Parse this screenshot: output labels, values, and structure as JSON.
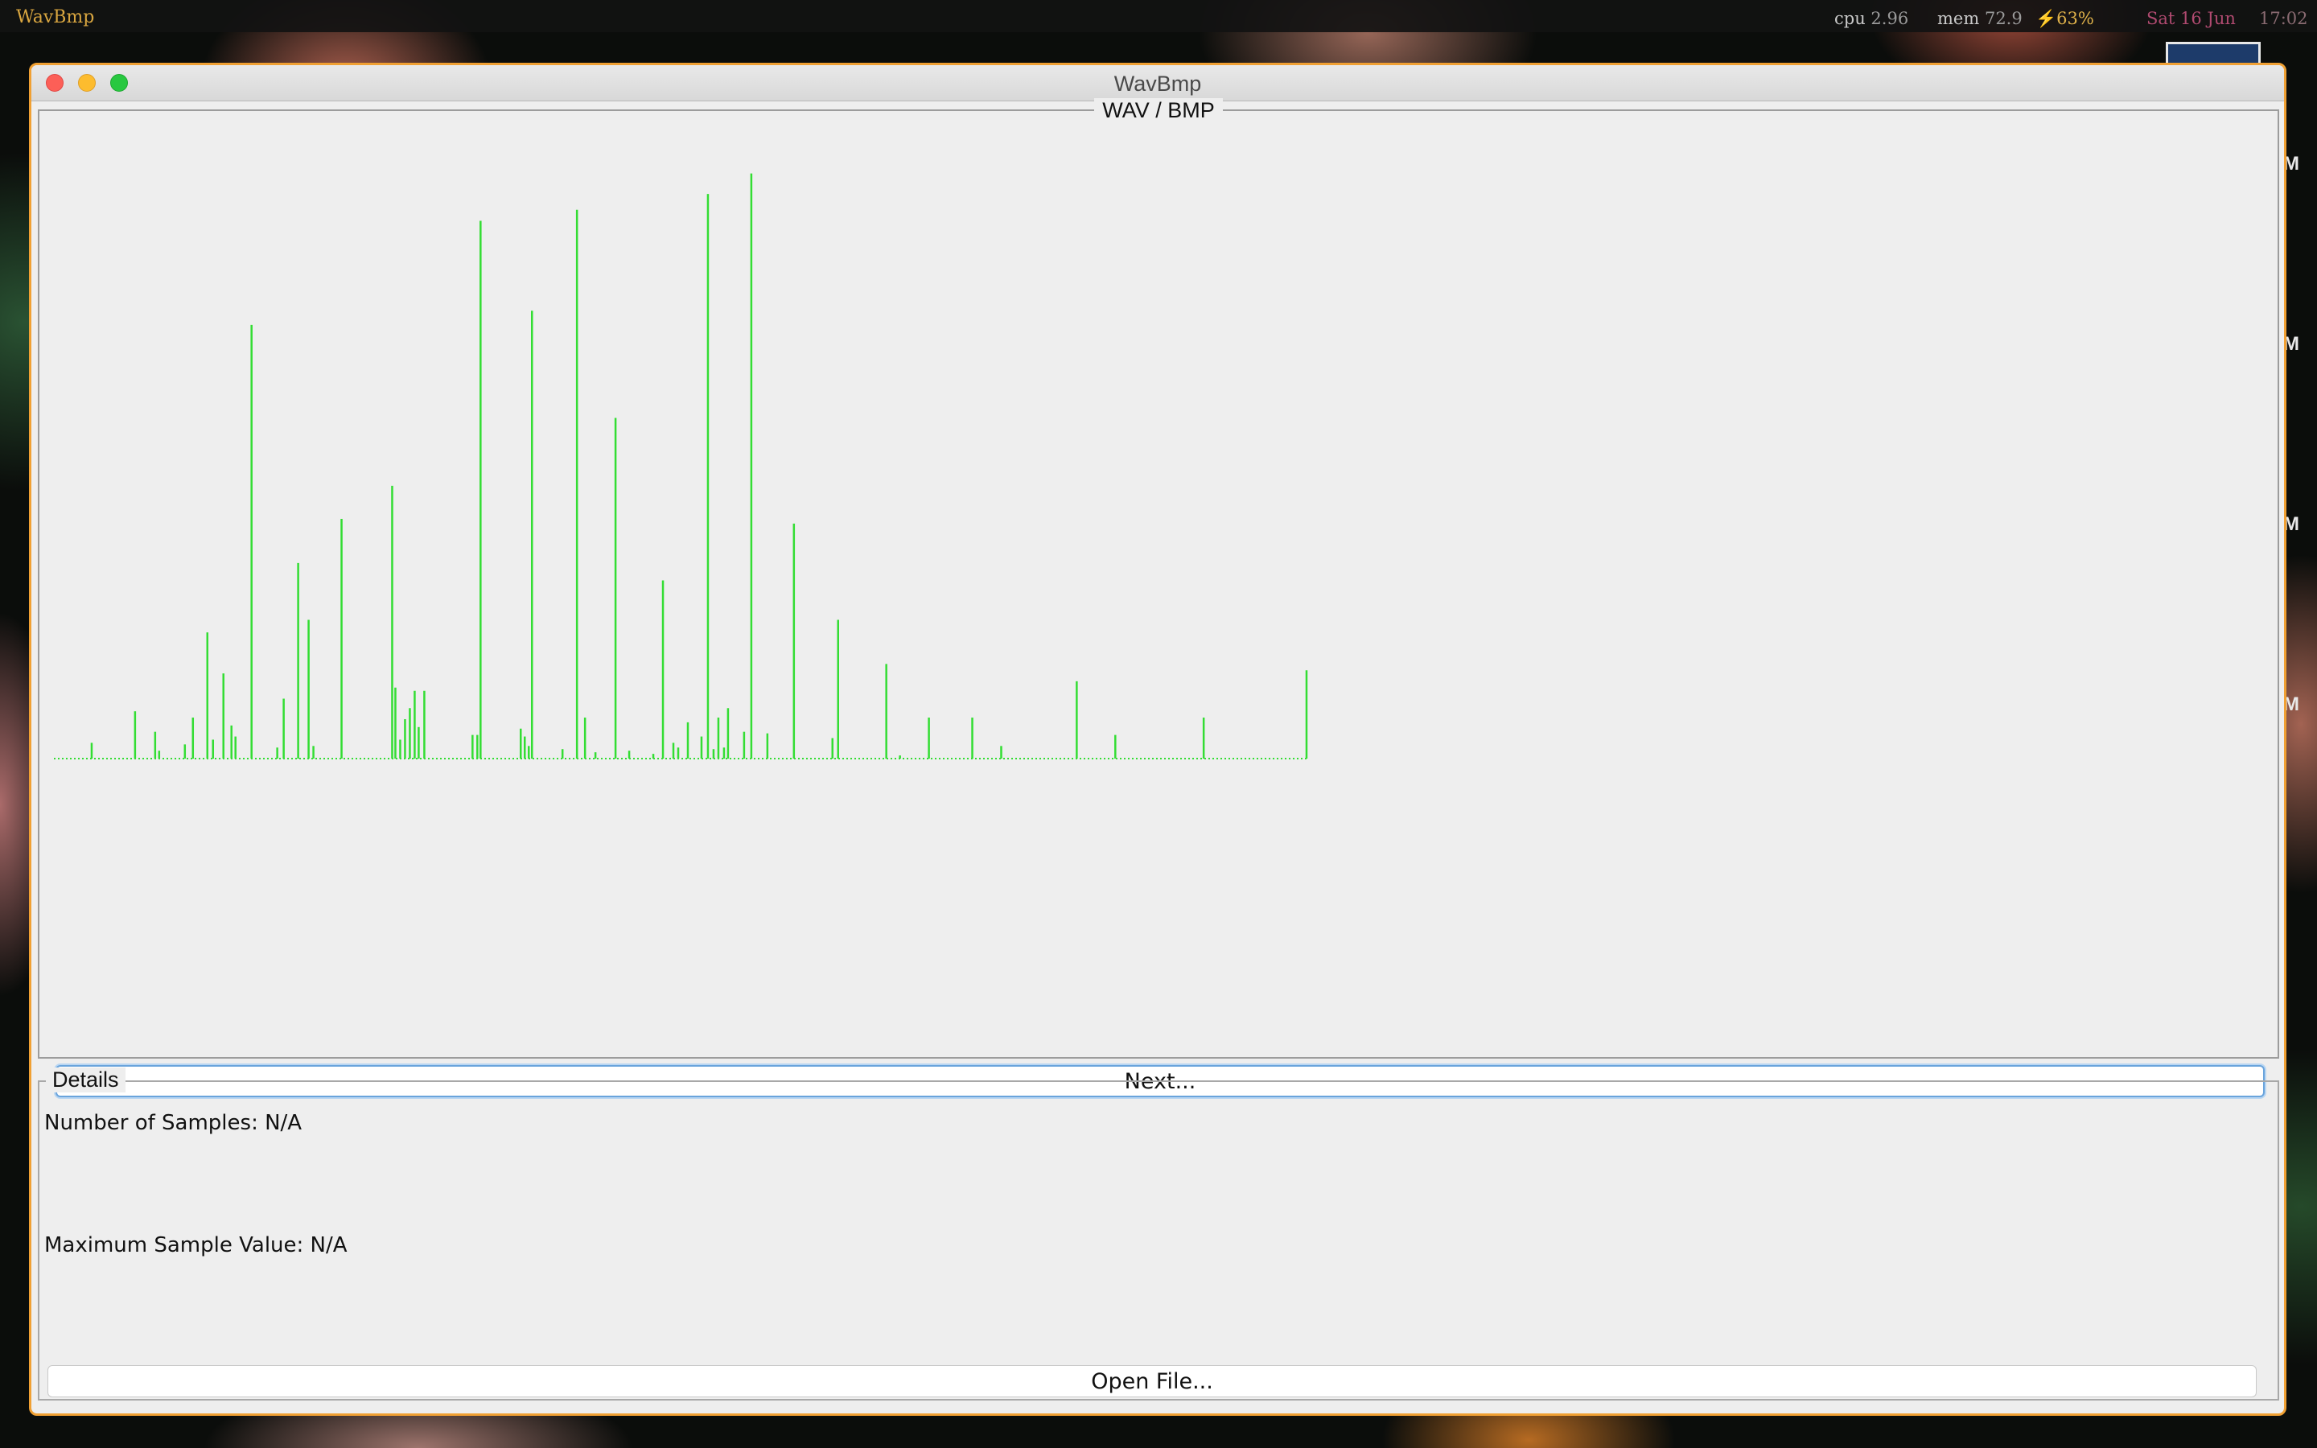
{
  "menubar": {
    "app_name": "WavBmp",
    "cpu_label": "cpu",
    "cpu_value": "2.96",
    "mem_label": "mem",
    "mem_value": "72.9",
    "battery": "⚡63%",
    "date": "Sat 16 Jun",
    "time": "17:02"
  },
  "desktop": {
    "side_labels": [
      "M",
      "M",
      "M",
      "M"
    ]
  },
  "window": {
    "title": "WavBmp",
    "chart_panel_title": "WAV / BMP",
    "next_button_label": "Next...",
    "details_title": "Details",
    "samples_label": "Number of Samples: N/A",
    "max_value_label": "Maximum Sample Value: N/A",
    "open_button_label": "Open File..."
  },
  "colors": {
    "waveform": "#33dd33",
    "window_border": "#f0a033",
    "focus_ring": "#6aa4dc"
  },
  "chart_data": {
    "type": "bar",
    "values": [
      0,
      0,
      0,
      0,
      0,
      0,
      0,
      0,
      1,
      0,
      0,
      0,
      0,
      0,
      0,
      0,
      3,
      0,
      0,
      0,
      0,
      0,
      0,
      0,
      0,
      0,
      1.5,
      0,
      0,
      0.5,
      0,
      0,
      0,
      0,
      0,
      0,
      1,
      0,
      2.7,
      0,
      0,
      0,
      0,
      0,
      0,
      0,
      0,
      0,
      1,
      0,
      0,
      0,
      0,
      1.6,
      0,
      0,
      0,
      0,
      0,
      0,
      0,
      0,
      0,
      0,
      0,
      0,
      27.5,
      0,
      0,
      0,
      0,
      0,
      0,
      0,
      0,
      0,
      0,
      0,
      0,
      0,
      0,
      0,
      0,
      0,
      12.8,
      0,
      0,
      0,
      8.8,
      0,
      0,
      0,
      0,
      0,
      0,
      0,
      0,
      0,
      0,
      0,
      0,
      0,
      0,
      0,
      0,
      15.1,
      0,
      0,
      0,
      0,
      0,
      0,
      0,
      0,
      0,
      0,
      0,
      0,
      0,
      0,
      0,
      0,
      0,
      0,
      0,
      0,
      0,
      0,
      0,
      0,
      0,
      0,
      0,
      0,
      0,
      0,
      0,
      0,
      0,
      0,
      0,
      0,
      0,
      0,
      0,
      0,
      0,
      0,
      0,
      0,
      0,
      0,
      0,
      0,
      0,
      0,
      0,
      0,
      0,
      0,
      0,
      0,
      0,
      0,
      0,
      0,
      0,
      0,
      0,
      0,
      0,
      0,
      0,
      0,
      0,
      0,
      0,
      0,
      0,
      0,
      0,
      0,
      0,
      0,
      0,
      0,
      0,
      0,
      0,
      0,
      0,
      0,
      0,
      0,
      0,
      0,
      0,
      0,
      0,
      0,
      0,
      0,
      0,
      0,
      0,
      0,
      0,
      0,
      0,
      0,
      0,
      0,
      0,
      0,
      0,
      0,
      0,
      0,
      0,
      0,
      0,
      0,
      0,
      0,
      0,
      0,
      0,
      0,
      0,
      0,
      0,
      0,
      0,
      0,
      0,
      0,
      0,
      0,
      0,
      0,
      0,
      0,
      0,
      0,
      0,
      0,
      0,
      0,
      0,
      0,
      0,
      0,
      0,
      0,
      0,
      0,
      0,
      0,
      0,
      0,
      0,
      0,
      0,
      0,
      0,
      0,
      0,
      0,
      0,
      0,
      0,
      0,
      0,
      0,
      0,
      0,
      0,
      0,
      0,
      0,
      0,
      0,
      0,
      0,
      0,
      0,
      0,
      0,
      0,
      0,
      0,
      0,
      0,
      0,
      0,
      0,
      0,
      0,
      0,
      0,
      0,
      0,
      0,
      0,
      0,
      0,
      0,
      0,
      0,
      0,
      0,
      0,
      0,
      0,
      0,
      0,
      0,
      0,
      0,
      0,
      0,
      0,
      0,
      0,
      0,
      0,
      0,
      0,
      0,
      0,
      0,
      0,
      0,
      0,
      0,
      0,
      0,
      0,
      0,
      0,
      0,
      0,
      0,
      0,
      0,
      0,
      0,
      0,
      0,
      0,
      0,
      0,
      0,
      0,
      0,
      0,
      0,
      0,
      0,
      0,
      0,
      0,
      0,
      0,
      0,
      0,
      0,
      0,
      0,
      0,
      0
    ],
    "pulses": [
      {
        "x": 46,
        "h": 1.0
      },
      {
        "x": 100,
        "h": 3.0
      },
      {
        "x": 125,
        "h": 1.7
      },
      {
        "x": 130,
        "h": 0.5
      },
      {
        "x": 162,
        "h": 0.9
      },
      {
        "x": 172,
        "h": 2.6
      },
      {
        "x": 190,
        "h": 8.0
      },
      {
        "x": 197,
        "h": 1.2
      },
      {
        "x": 210,
        "h": 5.4
      },
      {
        "x": 220,
        "h": 2.1
      },
      {
        "x": 225,
        "h": 1.4
      },
      {
        "x": 245,
        "h": 27.5
      },
      {
        "x": 277,
        "h": 0.7
      },
      {
        "x": 285,
        "h": 3.8
      },
      {
        "x": 303,
        "h": 12.4
      },
      {
        "x": 316,
        "h": 8.8
      },
      {
        "x": 322,
        "h": 0.8
      },
      {
        "x": 357,
        "h": 15.2
      },
      {
        "x": 420,
        "h": 17.3
      },
      {
        "x": 424,
        "h": 4.5
      },
      {
        "x": 430,
        "h": 1.2
      },
      {
        "x": 436,
        "h": 2.5
      },
      {
        "x": 442,
        "h": 3.2
      },
      {
        "x": 448,
        "h": 4.3
      },
      {
        "x": 453,
        "h": 2.0
      },
      {
        "x": 460,
        "h": 4.3
      },
      {
        "x": 520,
        "h": 1.5
      },
      {
        "x": 526,
        "h": 1.5
      },
      {
        "x": 530,
        "h": 34.1
      },
      {
        "x": 580,
        "h": 1.9
      },
      {
        "x": 585,
        "h": 1.4
      },
      {
        "x": 590,
        "h": 0.8
      },
      {
        "x": 594,
        "h": 28.4
      },
      {
        "x": 632,
        "h": 0.6
      },
      {
        "x": 650,
        "h": 34.8
      },
      {
        "x": 660,
        "h": 2.6
      },
      {
        "x": 673,
        "h": 0.4
      },
      {
        "x": 698,
        "h": 21.6
      },
      {
        "x": 715,
        "h": 0.5
      },
      {
        "x": 745,
        "h": 0.3
      },
      {
        "x": 757,
        "h": 11.3
      },
      {
        "x": 770,
        "h": 1.0
      },
      {
        "x": 776,
        "h": 0.7
      },
      {
        "x": 788,
        "h": 2.3
      },
      {
        "x": 805,
        "h": 1.4
      },
      {
        "x": 813,
        "h": 35.8
      },
      {
        "x": 820,
        "h": 0.6
      },
      {
        "x": 826,
        "h": 2.6
      },
      {
        "x": 833,
        "h": 0.7
      },
      {
        "x": 838,
        "h": 3.2
      },
      {
        "x": 858,
        "h": 1.7
      },
      {
        "x": 867,
        "h": 37.1
      },
      {
        "x": 887,
        "h": 1.6
      },
      {
        "x": 920,
        "h": 14.9
      },
      {
        "x": 968,
        "h": 1.3
      },
      {
        "x": 975,
        "h": 8.8
      },
      {
        "x": 1035,
        "h": 6.0
      },
      {
        "x": 1052,
        "h": 0.2
      },
      {
        "x": 1088,
        "h": 2.6
      },
      {
        "x": 1142,
        "h": 2.6
      },
      {
        "x": 1178,
        "h": 0.8
      },
      {
        "x": 1272,
        "h": 4.9
      },
      {
        "x": 1320,
        "h": 1.5
      },
      {
        "x": 1430,
        "h": 2.6
      },
      {
        "x": 1558,
        "h": 5.6
      }
    ],
    "x_range": [
      0,
      1560
    ],
    "y_range": [
      0,
      38
    ]
  }
}
